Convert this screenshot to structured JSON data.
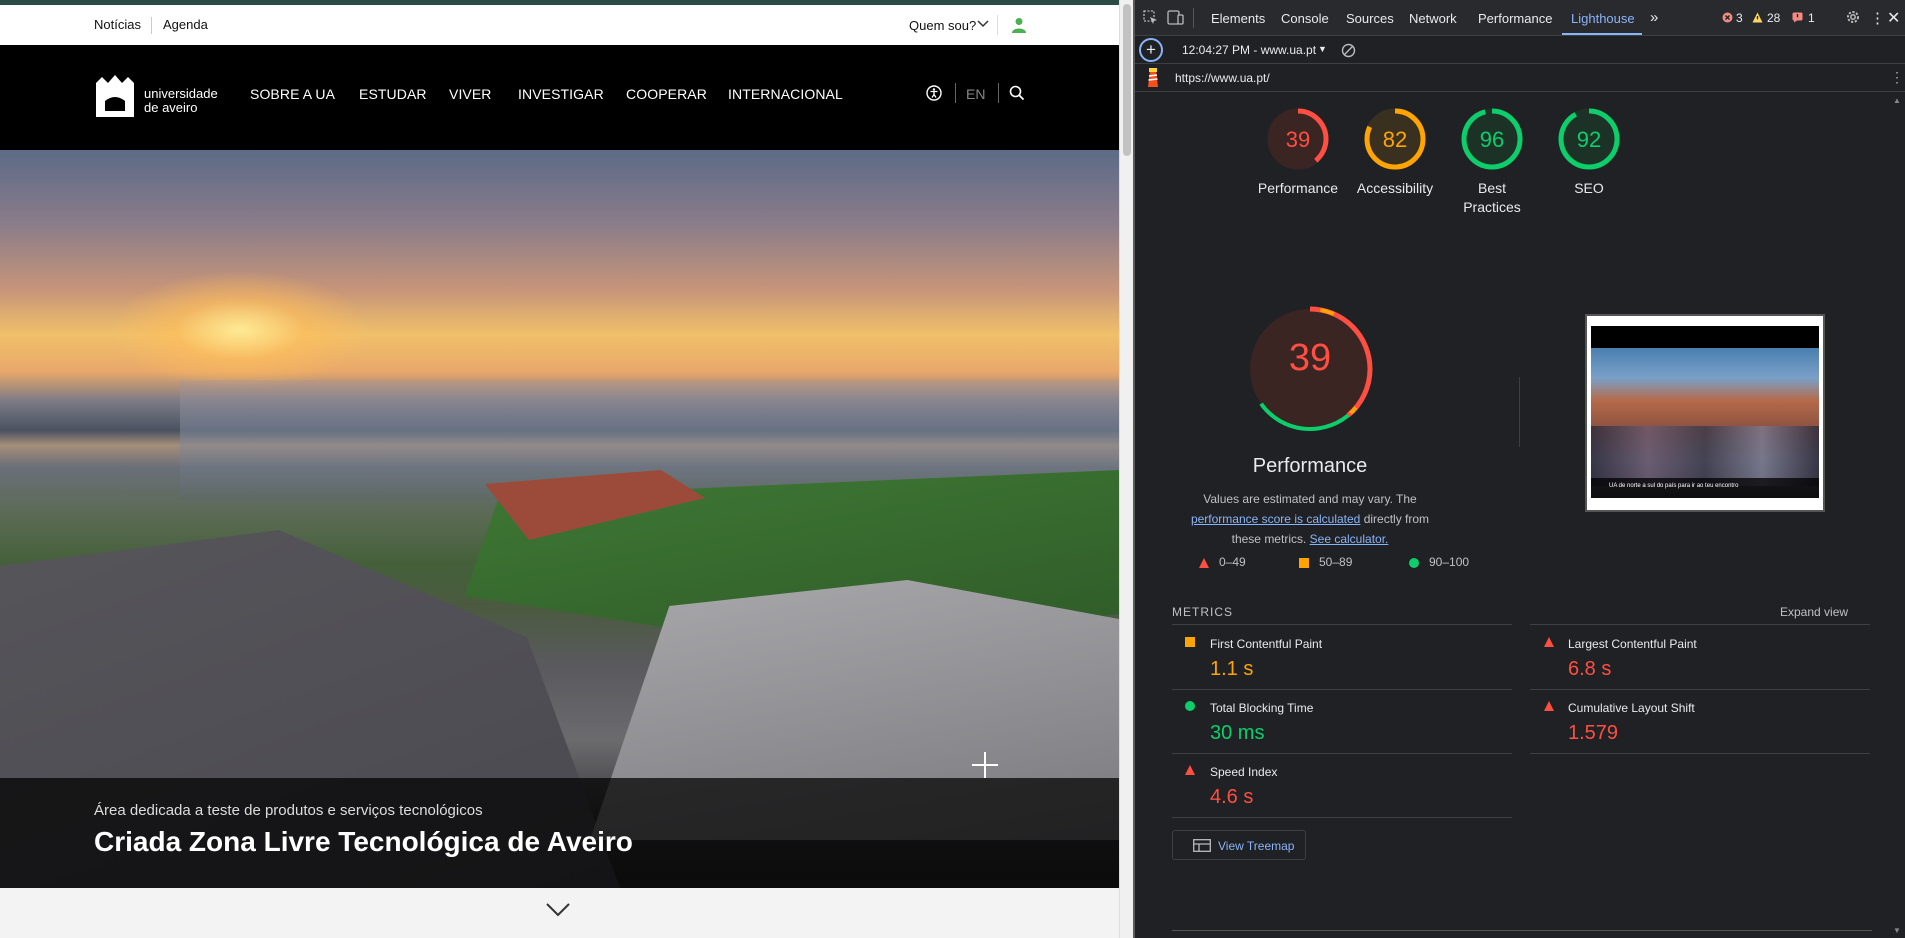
{
  "site": {
    "util_links": [
      "Notícias",
      "Agenda"
    ],
    "quem_sou": "Quem sou?",
    "logo_text_line1": "universidade",
    "logo_text_line2": "de aveiro",
    "nav_items": [
      "SOBRE A UA",
      "ESTUDAR",
      "VIVER",
      "INVESTIGAR",
      "COOPERAR",
      "INTERNACIONAL"
    ],
    "lang": "EN",
    "hero_subtitle": "Área dedicada a teste de produtos e serviços tecnológicos",
    "hero_title": "Criada Zona Livre Tecnológica de Aveiro"
  },
  "devtools": {
    "tabs": [
      "Elements",
      "Console",
      "Sources",
      "Network",
      "Performance",
      "Lighthouse"
    ],
    "active_tab": "Lighthouse",
    "errors": "3",
    "warnings": "28",
    "issues": "1",
    "report_selector": "12:04:27 PM - www.ua.pt",
    "url": "https://www.ua.pt/"
  },
  "lighthouse": {
    "scores": [
      {
        "label": "Performance",
        "value": 39,
        "color": "#ff4e42"
      },
      {
        "label": "Accessibility",
        "value": 82,
        "color": "#ffa400"
      },
      {
        "label": "Best Practices",
        "value": 96,
        "color": "#0cce6b"
      },
      {
        "label": "SEO",
        "value": 92,
        "color": "#0cce6b"
      }
    ],
    "main_score": 39,
    "main_label": "Performance",
    "note_prefix": "Values are estimated and may vary. The ",
    "note_link1": "performance score is calculated",
    "note_middle": " directly from these metrics. ",
    "note_link2": "See calculator.",
    "legend": [
      "0–49",
      "50–89",
      "90–100"
    ],
    "screenshot_caption": "UA de norte a sul do país para ir ao teu encontro",
    "metrics_title": "METRICS",
    "expand_view": "Expand view",
    "metrics": [
      {
        "name": "First Contentful Paint",
        "value": "1.1 s",
        "status": "average",
        "color": "#ffa400"
      },
      {
        "name": "Largest Contentful Paint",
        "value": "6.8 s",
        "status": "fail",
        "color": "#ff4e42"
      },
      {
        "name": "Total Blocking Time",
        "value": "30 ms",
        "status": "pass",
        "color": "#0cce6b"
      },
      {
        "name": "Cumulative Layout Shift",
        "value": "1.579",
        "status": "fail",
        "color": "#ff4e42"
      },
      {
        "name": "Speed Index",
        "value": "4.6 s",
        "status": "fail",
        "color": "#ff4e42"
      }
    ],
    "treemap_label": "View Treemap"
  }
}
